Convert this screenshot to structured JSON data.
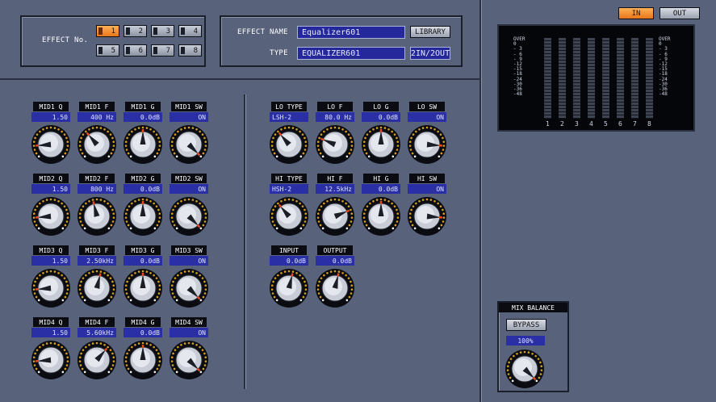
{
  "effect_no": {
    "label": "EFFECT No.",
    "buttons": [
      "1",
      "2",
      "3",
      "4",
      "5",
      "6",
      "7",
      "8"
    ],
    "active": "1"
  },
  "effect": {
    "name_label": "EFFECT NAME",
    "name_value": "Equalizer601",
    "library_button": "LIBRARY",
    "type_label": "TYPE",
    "type_value": "EQUALIZER601",
    "io_value": "2IN/2OUT"
  },
  "io_toggle": {
    "in_label": "IN",
    "out_label": "OUT"
  },
  "meter": {
    "scale": [
      "OVER",
      "0",
      "- 3",
      "- 6",
      "- 9",
      "-12",
      "-15",
      "-18",
      "-24",
      "-30",
      "-36",
      "-48"
    ],
    "channels": [
      "1",
      "2",
      "3",
      "4",
      "5",
      "6",
      "7",
      "8"
    ]
  },
  "mid_params": [
    [
      {
        "label": "MID1 Q",
        "value": "1.50",
        "level": 0.15
      },
      {
        "label": "MID1 F",
        "value": "400 Hz",
        "level": 0.35
      },
      {
        "label": "MID1 G",
        "value": "0.0dB",
        "level": 0.5
      },
      {
        "label": "MID1 SW",
        "value": "ON",
        "level": 1.0
      }
    ],
    [
      {
        "label": "MID2 Q",
        "value": "1.50",
        "level": 0.15
      },
      {
        "label": "MID2 F",
        "value": "800 Hz",
        "level": 0.45
      },
      {
        "label": "MID2 G",
        "value": "0.0dB",
        "level": 0.5
      },
      {
        "label": "MID2 SW",
        "value": "ON",
        "level": 1.0
      }
    ],
    [
      {
        "label": "MID3 Q",
        "value": "1.50",
        "level": 0.15
      },
      {
        "label": "MID3 F",
        "value": "2.50kHz",
        "level": 0.55
      },
      {
        "label": "MID3 G",
        "value": "0.0dB",
        "level": 0.5
      },
      {
        "label": "MID3 SW",
        "value": "ON",
        "level": 1.0
      }
    ],
    [
      {
        "label": "MID4 Q",
        "value": "1.50",
        "level": 0.15
      },
      {
        "label": "MID4 F",
        "value": "5.60kHz",
        "level": 0.65
      },
      {
        "label": "MID4 G",
        "value": "0.0dB",
        "level": 0.5
      },
      {
        "label": "MID4 SW",
        "value": "ON",
        "level": 1.0
      }
    ]
  ],
  "band_params": [
    [
      {
        "label": "LO TYPE",
        "value": "LSH-2",
        "level": 0.35,
        "align": "left"
      },
      {
        "label": "LO F",
        "value": "80.0 Hz",
        "level": 0.25
      },
      {
        "label": "LO G",
        "value": "0.0dB",
        "level": 0.5
      },
      {
        "label": "LO SW",
        "value": "ON",
        "level": 0.85
      }
    ],
    [
      {
        "label": "HI TYPE",
        "value": "HSH-2",
        "level": 0.35,
        "align": "left"
      },
      {
        "label": "HI F",
        "value": "12.5kHz",
        "level": 0.75
      },
      {
        "label": "HI G",
        "value": "0.0dB",
        "level": 0.5
      },
      {
        "label": "HI SW",
        "value": "ON",
        "level": 0.85
      }
    ],
    [
      {
        "label": "INPUT",
        "value": "0.0dB",
        "level": 0.55
      },
      {
        "label": "OUTPUT",
        "value": "0.0dB",
        "level": 0.55
      }
    ]
  ],
  "mix_balance": {
    "title": "MIX BALANCE",
    "bypass_label": "BYPASS",
    "value": "100%",
    "level": 1.0
  },
  "colors": {
    "background": "#58627a",
    "lcd": "#25289a",
    "active_button": "#f08a2a",
    "knob_ring": "#d4a020",
    "knob_pointer": "#e84820"
  }
}
